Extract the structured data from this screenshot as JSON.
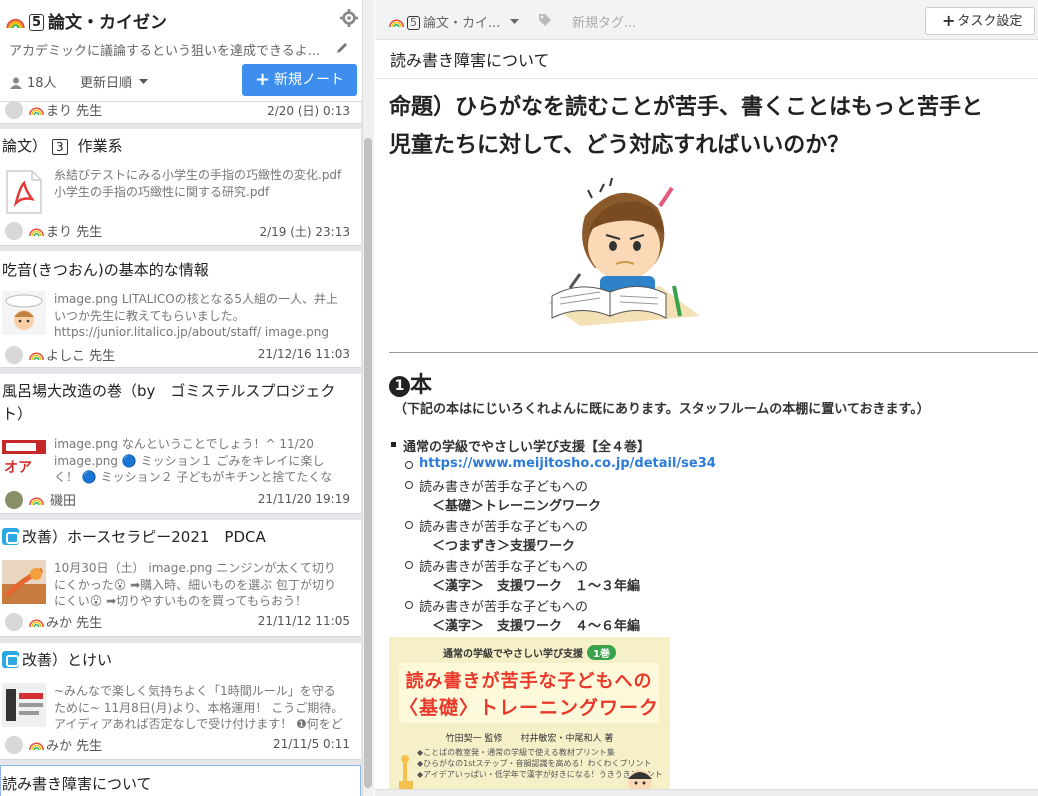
{
  "board": {
    "title_num": "5",
    "title": "論文・カイゼン",
    "description": "アカデミックに議論するという狙いを達成できるよ...",
    "members": "18人",
    "sort_label": "更新日順",
    "new_note_label": "新規ノート"
  },
  "notes": [
    {
      "author": "まり 先生",
      "date": "2/20 (日) 0:13"
    },
    {
      "title_prefix": "論文）",
      "title_num": "3",
      "title": "作業系",
      "excerpt_lines": [
        "糸結びテストにみる小学生の手指の巧緻性の変化.pdf",
        "小学生の手指の巧緻性に関する研究.pdf"
      ],
      "author": "まり 先生",
      "date": "2/19 (土) 23:13"
    },
    {
      "title": "吃音(きつおん)の基本的な情報",
      "excerpt": "image.png LITALICOの核となる5人組の一人、井上いつか先生に教えてもらいました。https://junior.litalico.jp/about/staff/ image.png というのも、山口あやこさん",
      "author": "よしこ 先生",
      "date": "21/12/16 11:03"
    },
    {
      "title": "風呂場大改造の巻（by　ゴミステルスプロジェクト）",
      "excerpt": "image.png なんということでしょう！^ 11/20 image.png 🔵 ミッション１ ごみをキレイに楽しく！ 🔵 ミッション２ 子どもがキチンと捨てたくなる！ 🔵 ミッシ",
      "author": "磯田",
      "date": "21/11/20 19:19"
    },
    {
      "title": "改善）ホースセラピー2021　PDCA",
      "excerpt": "10月30日（土） image.png ニンジンが太くて切りにくかった😮 ➡購入時、細いものを選ぶ 包丁が切りにくい😮 ➡切りやすいものを買ってもらおう！ https://",
      "author": "みか 先生",
      "date": "21/11/12 11:05"
    },
    {
      "title": "改善）とけい",
      "excerpt": "~みんなで楽しく気持ちよく「1時間ルール」を守るために~ 11月8日(月)より、本格運用！ こうご期待。アイディアあれば否定なしで受け付けます！ ❶何をど",
      "author": "みか 先生",
      "date": "21/11/5 0:11"
    },
    {
      "title": "読み書き障害について"
    }
  ],
  "topbar": {
    "breadcrumb_num": "5",
    "breadcrumb": "論文・カイ...",
    "tag_placeholder": "新規タグ...",
    "task_settings": "タスク設定"
  },
  "note": {
    "title": "読み書き障害について",
    "heading_line1": "命題）ひらがなを読むことが苦手、書くことはもっと苦手と",
    "heading_line2": "児童たちに対して、どう対応すればいいのか？",
    "section_num": "1",
    "section_title": "本",
    "section_note": "（下記の本はにじいろくれよんに既にあります。スタッフルームの本棚に置いておきます。）",
    "series": "通常の学級でやさしい学び支援【全４巻】",
    "link": "https://www.meijitosho.co.jp/detail/se34",
    "books": [
      {
        "line1": "読み書きが苦手な子どもへの",
        "line2": "＜基礎＞トレーニングワーク"
      },
      {
        "line1": "読み書きが苦手な子どもへの",
        "line2": "＜つまずき＞支援ワーク"
      },
      {
        "line1": "読み書きが苦手な子どもへの",
        "line2": "＜漢字＞　支援ワーク　１～３年編"
      },
      {
        "line1": "読み書きが苦手な子どもへの",
        "line2": "＜漢字＞　支援ワーク　４～６年編"
      }
    ],
    "cover": {
      "series": "通常の学級でやさしい学び支援",
      "volume": "1巻",
      "title_line1": "読み書きが苦手な子どもへの",
      "title_line2": "〈基礎〉トレーニングワーク",
      "author": "竹田契一 監修　　村井敏宏・中尾和人 著",
      "point1": "◆ことばの教室発・通常の学級で使える教材プリント集",
      "point2": "◆ひらがなの1stステップ・音韻認識を高める！わくわくプリント",
      "point3": "◆アイデアいっぱい・低学年で漢字が好きになる！うきうきプリント"
    }
  }
}
